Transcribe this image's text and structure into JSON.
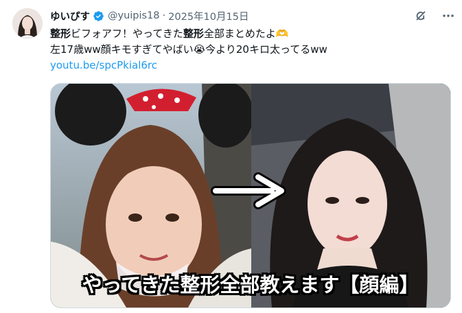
{
  "author": {
    "display_name": "ゆいぴす",
    "handle": "@yuipis18",
    "separator": "·",
    "date": "2025年10月15日"
  },
  "tweet": {
    "line1_bold1": "整形",
    "line1_text1": "ビフォアフ！やってきた",
    "line1_bold2": "整形",
    "line1_text2": "全部まとめたよ🫶",
    "line2": "左17歳ww顔キモすぎてやばい😭今より20キロ太ってるww",
    "link": "youtu.be/spcPkial6rc"
  },
  "media": {
    "caption": "やってきた整形全部教えます【顔編】",
    "alt": "Before/after comparison photo"
  },
  "icons": {
    "verified": "verified-badge-icon",
    "grok": "grok-icon",
    "more": "more-options-icon",
    "arrow": "right-arrow-icon"
  },
  "colors": {
    "link": "#1d9bf0",
    "verified": "#1d9bf0",
    "meta": "#536471"
  }
}
